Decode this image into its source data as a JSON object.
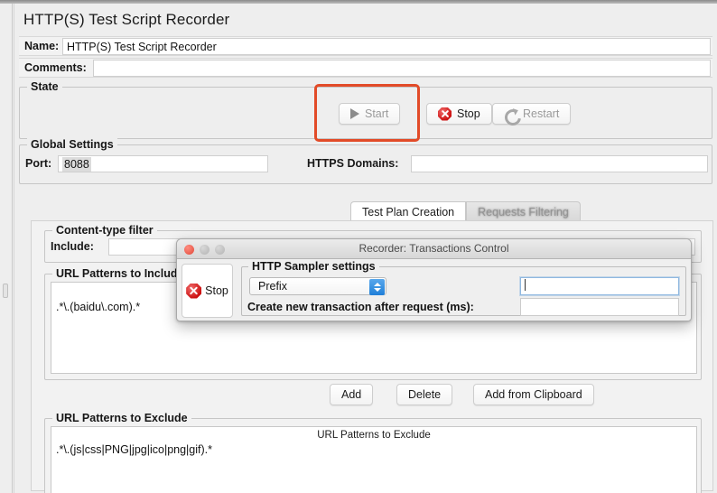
{
  "window": {
    "title": "HTTP(S) Test Script Recorder"
  },
  "name_row": {
    "label": "Name:",
    "value": "HTTP(S) Test Script Recorder"
  },
  "comments_row": {
    "label": "Comments:",
    "value": ""
  },
  "state_group": {
    "title": "State",
    "buttons": [
      {
        "label": "Start",
        "icon": "play-icon",
        "enabled": false
      },
      {
        "label": "Stop",
        "icon": "stop-icon",
        "enabled": true
      },
      {
        "label": "Restart",
        "icon": "restart-icon",
        "enabled": false
      }
    ]
  },
  "global_settings": {
    "title": "Global Settings",
    "port_label": "Port:",
    "port_value": "8088",
    "https_domains_label": "HTTPS Domains:",
    "https_domains_value": ""
  },
  "tabs": [
    {
      "label": "Test Plan Creation",
      "active": true
    },
    {
      "label": "Requests Filtering",
      "active": false
    }
  ],
  "content_type_filter": {
    "title": "Content-type filter",
    "include_label": "Include:",
    "include_value": ""
  },
  "url_include": {
    "title": "URL Patterns to Include",
    "rows": [
      ".*\\.(baidu\\.com).*"
    ]
  },
  "list_buttons": [
    {
      "label": "Add"
    },
    {
      "label": "Delete"
    },
    {
      "label": "Add from Clipboard"
    }
  ],
  "url_exclude": {
    "title": "URL Patterns to Exclude",
    "column_header": "URL Patterns to Exclude",
    "rows": [
      ".*\\.(js|css|PNG|jpg|ico|png|gif).*"
    ]
  },
  "dialog": {
    "title": "Recorder: Transactions Control",
    "traffic_lights": [
      "close-light",
      "minimize-light",
      "zoom-light"
    ],
    "stop_button": {
      "label": "Stop",
      "icon": "stop-icon"
    },
    "sampler_group": {
      "title": "HTTP Sampler settings",
      "naming_mode": "Prefix",
      "prefix_value": "",
      "transaction_label": "Create new transaction after request (ms):",
      "transaction_value": ""
    }
  },
  "annotation": {
    "color": "#e24b28",
    "target": "start-button"
  },
  "colors": {
    "accent_blue": "#1f7fd8",
    "stop_red": "#cc1111",
    "annotation_red": "#e24b28",
    "window_bg": "#eeeeee"
  }
}
